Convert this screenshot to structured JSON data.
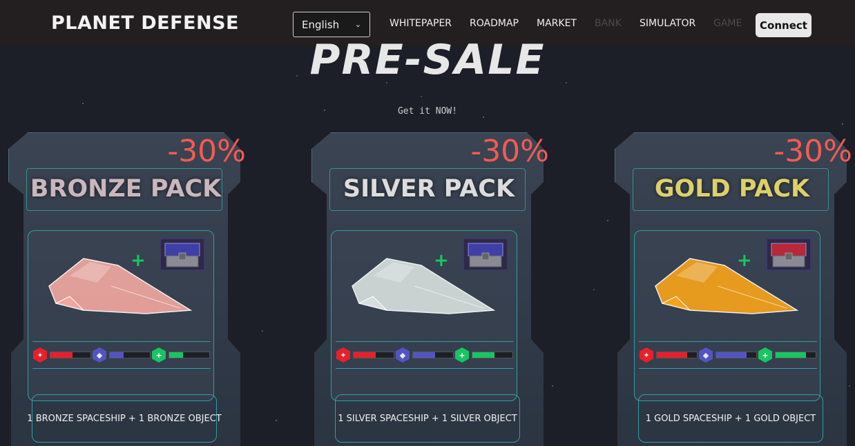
{
  "nav": {
    "logo": "PLANET DEFENSE",
    "language": "English",
    "links": [
      "WHITEPAPER",
      "ROADMAP",
      "MARKET",
      "BANK",
      "SIMULATOR",
      "GAME"
    ],
    "connect": "Connect"
  },
  "hero": {
    "title": "PRE-SALE",
    "tagline": "Get it NOW!"
  },
  "packs": [
    {
      "discount": "-30%",
      "title": "BRONZE PACK",
      "title_color": "#c9b7bc",
      "ship_color": "#f0a7a0",
      "chest_color": "#3f3fa8",
      "description": "1 BRONZE SPACESHIP + 1 BRONZE OBJECT",
      "stats": {
        "attack": 0.55,
        "shield": 0.35,
        "health": 0.35
      }
    },
    {
      "discount": "-30%",
      "title": "SILVER PACK",
      "title_color": "#dcdcdc",
      "ship_color": "#d7dedd",
      "chest_color": "#3f3fa8",
      "description": "1 SILVER SPACESHIP + 1 SILVER OBJECT",
      "stats": {
        "attack": 0.55,
        "shield": 0.55,
        "health": 0.55
      }
    },
    {
      "discount": "-30%",
      "title": "GOLD PACK",
      "title_color": "#dcd06a",
      "ship_color": "#f5a21a",
      "chest_color": "#b8283a",
      "description": "1 GOLD SPACESHIP + 1 GOLD OBJECT",
      "stats": {
        "attack": 0.75,
        "shield": 0.75,
        "health": 0.75
      }
    }
  ],
  "colors": {
    "accent_red": "#f25b52",
    "attack": "#e8202c",
    "shield": "#5254c6",
    "health": "#19c463",
    "frame": "#2fa0a5"
  }
}
